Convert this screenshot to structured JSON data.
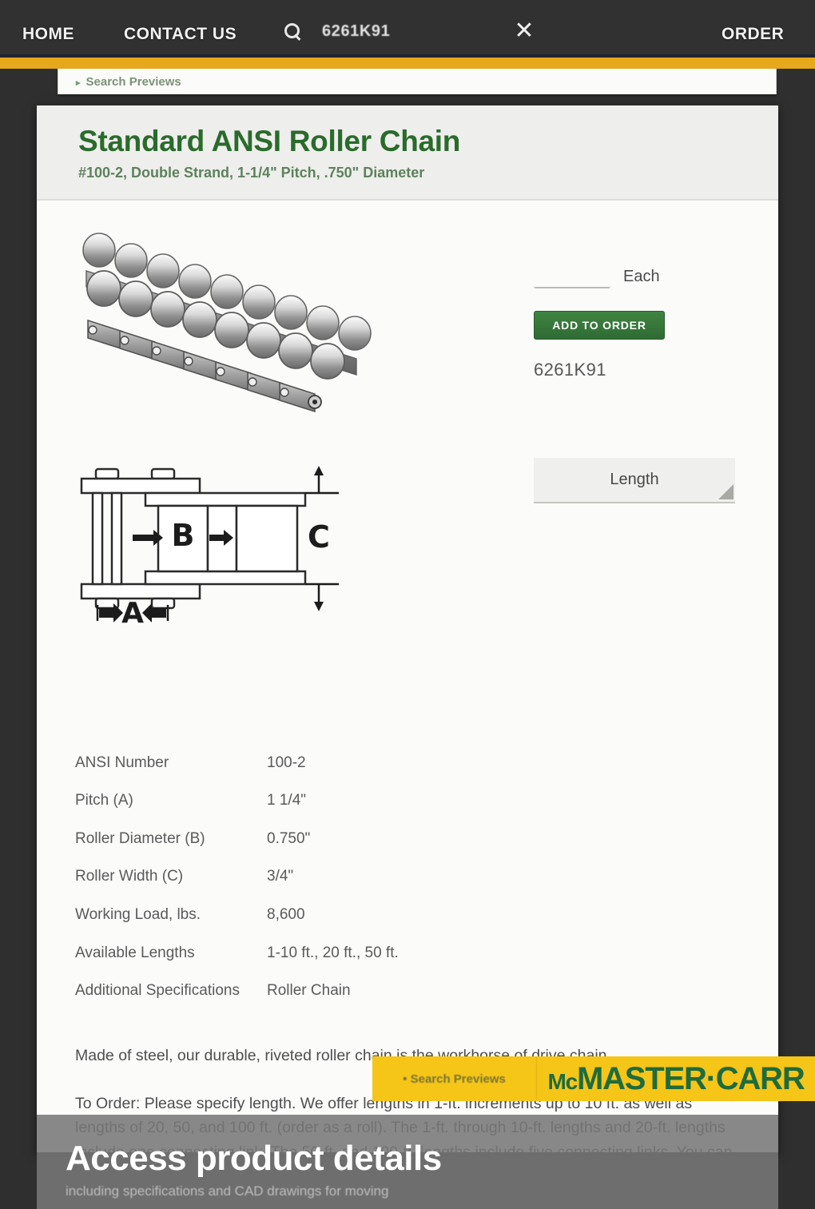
{
  "topnav": {
    "home_label": "HOME",
    "contact_label": "CONTACT US",
    "order_label": "ORDER",
    "search_value": "6261K91",
    "search_placeholder": "Search",
    "clear_glyph": "✕",
    "search_icon": "search-icon"
  },
  "search_preview_tab": {
    "bullet": "▸",
    "label": "Search Previews"
  },
  "product": {
    "title": "Standard ANSI Roller Chain",
    "subtitle": "#100-2, Double Strand, 1-1/4\" Pitch, .750\" Diameter",
    "part_number": "6261K91",
    "photo_alt": "double-strand-roller-chain-photo",
    "diagram_alt": "roller-chain-dimension-diagram",
    "diagram_labels": {
      "a": "A",
      "b": "B",
      "c": "C"
    }
  },
  "purchase": {
    "qty_value": "",
    "qty_placeholder": "",
    "unit_label": "Each",
    "add_to_order_label": "ADD TO ORDER",
    "length_label": "Length"
  },
  "specs": {
    "rows": [
      {
        "label": "ANSI Number",
        "value": "100-2"
      },
      {
        "label": "Pitch (A)",
        "value": "1 1/4\""
      },
      {
        "label": "Roller Diameter (B)",
        "value": "0.750\""
      },
      {
        "label": "Roller Width (C)",
        "value": "3/4\""
      },
      {
        "label": "Working Load, lbs.",
        "value": "8,600"
      },
      {
        "label": "Available Lengths",
        "value": "1-10 ft., 20 ft., 50 ft."
      },
      {
        "label": "Additional Specifications",
        "value": "Roller Chain"
      }
    ]
  },
  "description": {
    "paragraph1": "Made of steel, our durable, riveted roller chain is the workhorse of drive chain.",
    "paragraph2": "To Order: Please specify length. We offer lengths in 1-ft. increments up to 10 ft. as well as lengths of 20, 50, and 100 ft. (order as a roll). The 1-ft. through 10-ft. lengths and 20-ft. lengths include one connecting link. The 50-ft. and 100-ft. lengths include five connecting links. You can also order single or double connecting links."
  },
  "brand_bar": {
    "preview_bullet": "•",
    "preview_label": "Search Previews",
    "logo_mc": "Mc",
    "logo_main": "MASTER·CARR"
  },
  "bottom_overlay": {
    "title": "Access product details",
    "subtitle": "including specifications and CAD drawings for moving"
  },
  "colors": {
    "brand_yellow": "#f5c518",
    "brand_green": "#1f6b3b",
    "title_green": "#2a6b2c",
    "button_green": "#2f6b33",
    "nav_dark": "#313131"
  }
}
